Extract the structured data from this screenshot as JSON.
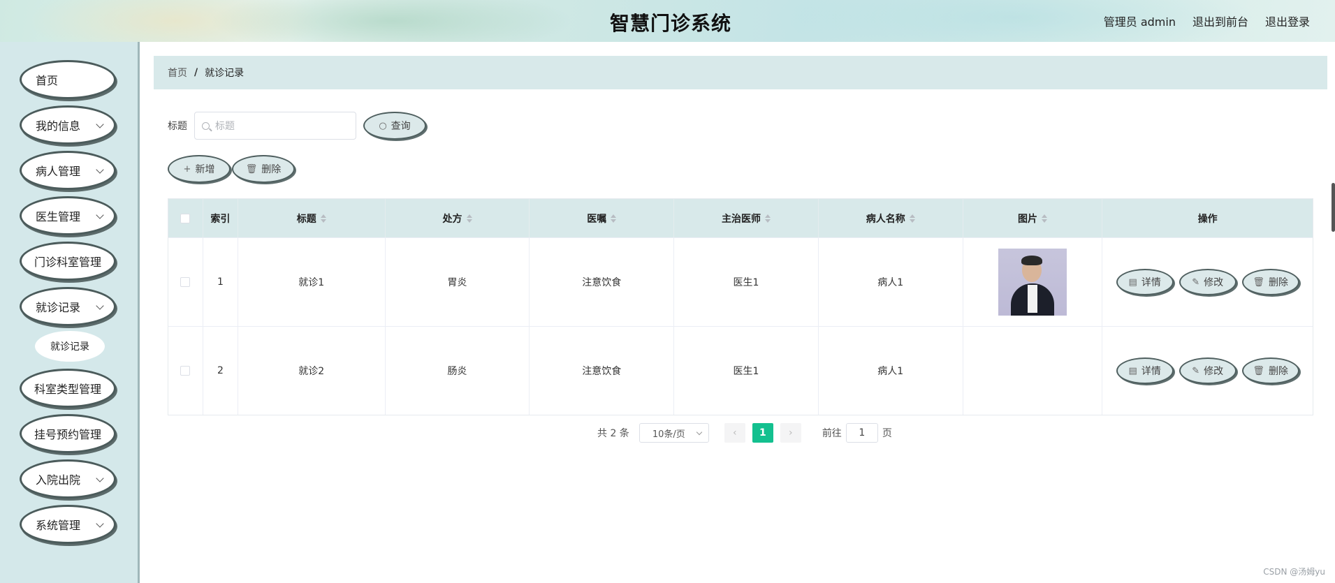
{
  "header": {
    "title": "智慧门诊系统",
    "user_label": "管理员 admin",
    "to_front": "退出到前台",
    "logout": "退出登录"
  },
  "sidebar": {
    "items": [
      {
        "label": "首页",
        "has_children": false
      },
      {
        "label": "我的信息",
        "has_children": true
      },
      {
        "label": "病人管理",
        "has_children": true
      },
      {
        "label": "医生管理",
        "has_children": true
      },
      {
        "label": "门诊科室管理",
        "has_children": false
      },
      {
        "label": "就诊记录",
        "has_children": true
      },
      {
        "label": "科室类型管理",
        "has_children": false
      },
      {
        "label": "挂号预约管理",
        "has_children": false
      },
      {
        "label": "入院出院",
        "has_children": true
      },
      {
        "label": "系统管理",
        "has_children": true
      }
    ],
    "submenu": {
      "label": "就诊记录"
    }
  },
  "breadcrumb": {
    "home": "首页",
    "sep": "/",
    "current": "就诊记录"
  },
  "search": {
    "label": "标题",
    "placeholder": "标题",
    "query_btn": "查询"
  },
  "actions": {
    "add": "新增",
    "delete": "删除"
  },
  "table": {
    "columns": [
      "索引",
      "标题",
      "处方",
      "医嘱",
      "主治医师",
      "病人名称",
      "图片",
      "操作"
    ],
    "rows": [
      {
        "index": "1",
        "title": "就诊1",
        "prescription": "胃炎",
        "advice": "注意饮食",
        "doctor": "医生1",
        "patient": "病人1",
        "has_image": true
      },
      {
        "index": "2",
        "title": "就诊2",
        "prescription": "肠炎",
        "advice": "注意饮食",
        "doctor": "医生1",
        "patient": "病人1",
        "has_image": false
      }
    ],
    "row_actions": {
      "detail": "详情",
      "edit": "修改",
      "delete": "删除"
    }
  },
  "pager": {
    "total": "共 2 条",
    "page_size": "10条/页",
    "current_page": "1",
    "goto_prefix": "前往",
    "goto_value": "1",
    "goto_suffix": "页"
  },
  "watermark": "CSDN @汤姆yu",
  "colors": {
    "accent": "#13c08f",
    "sidebar_bg": "#d4e8ea",
    "header_row": "#d8e9ea"
  }
}
